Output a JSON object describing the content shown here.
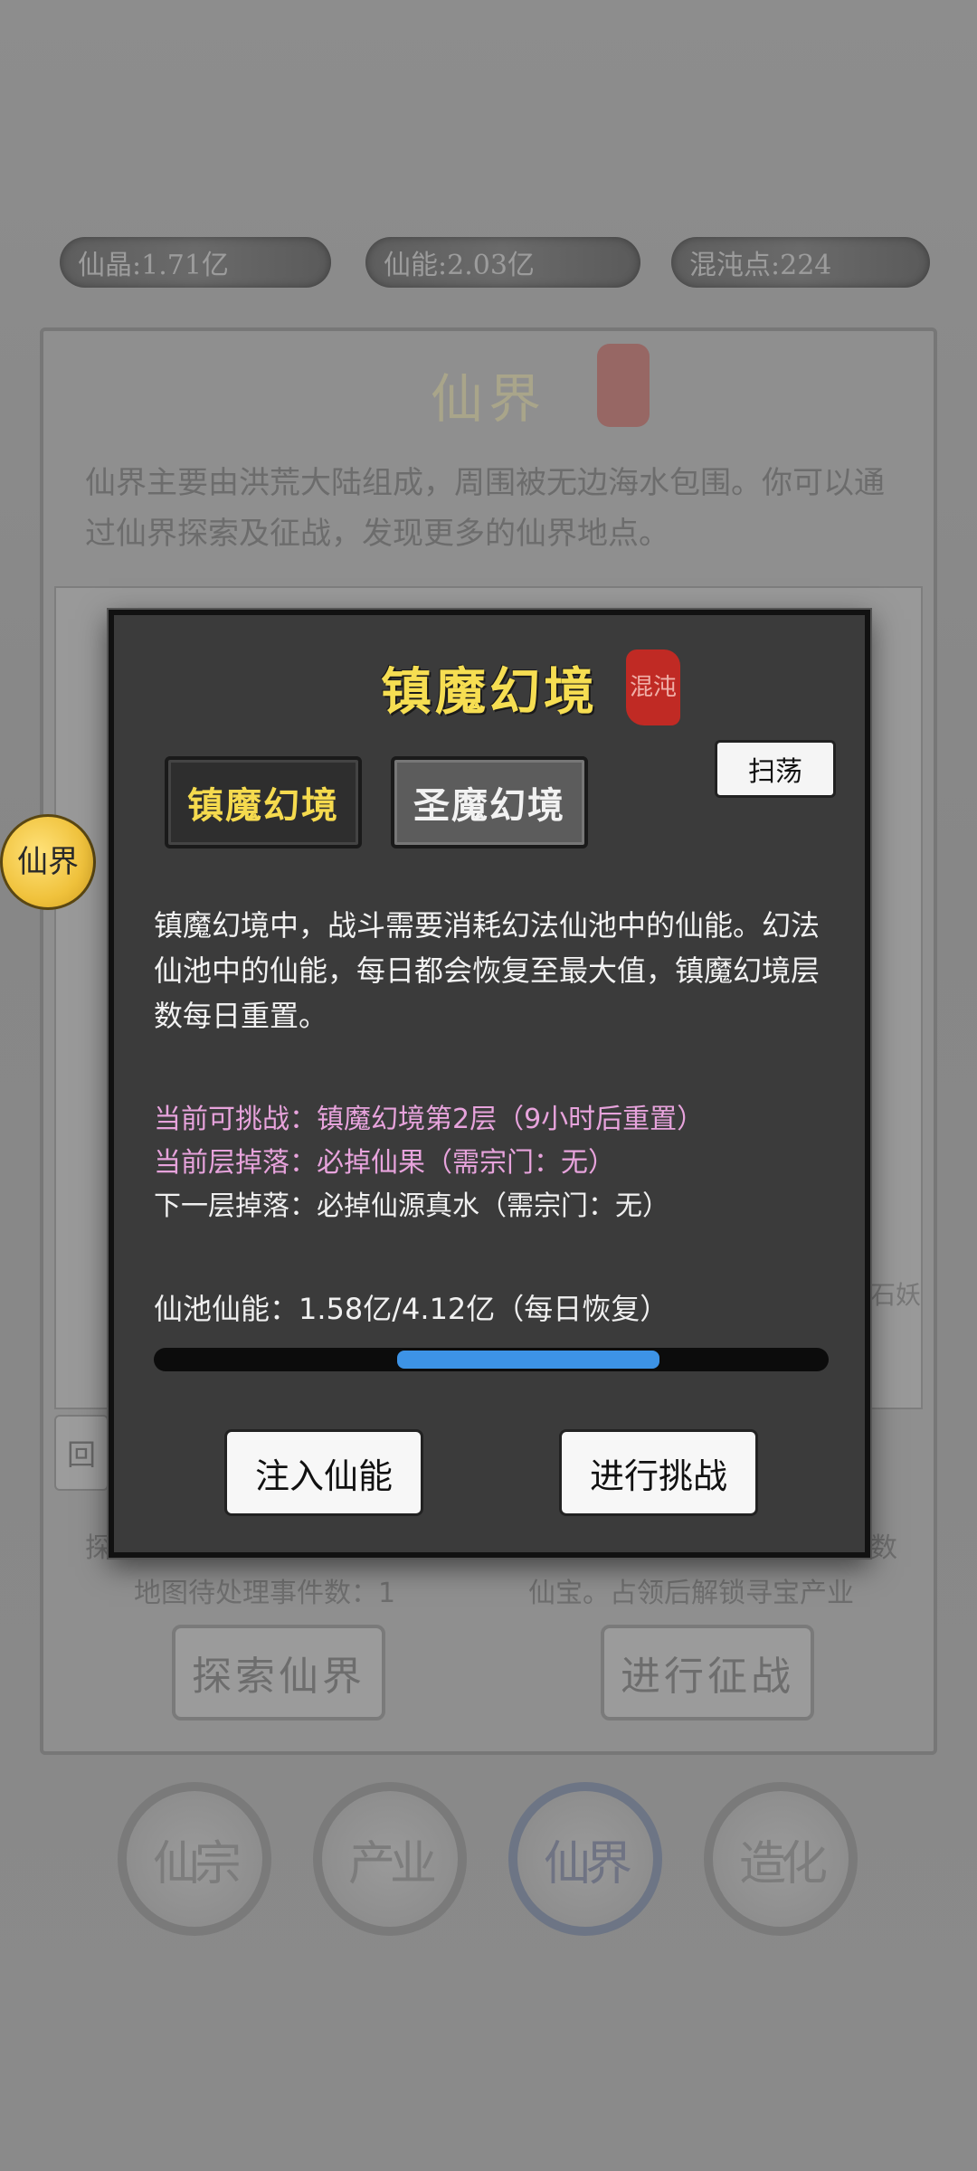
{
  "resources": [
    {
      "label": "仙晶:1.71亿"
    },
    {
      "label": "仙能:2.03亿"
    },
    {
      "label": "混沌点:224"
    }
  ],
  "panel": {
    "title": "仙界",
    "description": "仙界主要由洪荒大陆组成，周围被无边海水包围。你可以通过仙界探索及征战，发现更多的仙界地点。",
    "back_label": "回",
    "map_glyph": "石妖",
    "edge_left": "探",
    "edge_right": "数",
    "pending_events": "地图待处理事件数：1",
    "battle_info": "仙宝。占领后解锁寻宝产业",
    "explore_button": "探索仙界",
    "battle_button": "进行征战"
  },
  "side_badge": "仙界",
  "nav": [
    {
      "label": "仙宗",
      "active": false
    },
    {
      "label": "产业",
      "active": false
    },
    {
      "label": "仙界",
      "active": true
    },
    {
      "label": "造化",
      "active": false
    }
  ],
  "modal": {
    "title": "镇魔幻境",
    "seal": "混沌",
    "tabs": [
      {
        "label": "镇魔幻境",
        "active": true
      },
      {
        "label": "圣魔幻境",
        "active": false
      }
    ],
    "sweep_button": "扫荡",
    "description": "镇魔幻境中，战斗需要消耗幻法仙池中的仙能。幻法仙池中的仙能，每日都会恢复至最大值，镇魔幻境层数每日重置。",
    "current_challenge": "当前可挑战：镇魔幻境第2层（9小时后重置）",
    "current_drop": "当前层掉落：必掉仙果（需宗门：无）",
    "next_drop": "下一层掉落：必掉仙源真水（需宗门：无）",
    "pool_text": "仙池仙能：1.58亿/4.12亿（每日恢复）",
    "pool_progress": {
      "start": 0.36,
      "end": 0.75
    },
    "inject_button": "注入仙能",
    "challenge_button": "进行挑战"
  },
  "colors": {
    "title_gold": "#f6de52",
    "pink_text": "#e7a3dc",
    "progress_blue": "#3d93e6"
  }
}
